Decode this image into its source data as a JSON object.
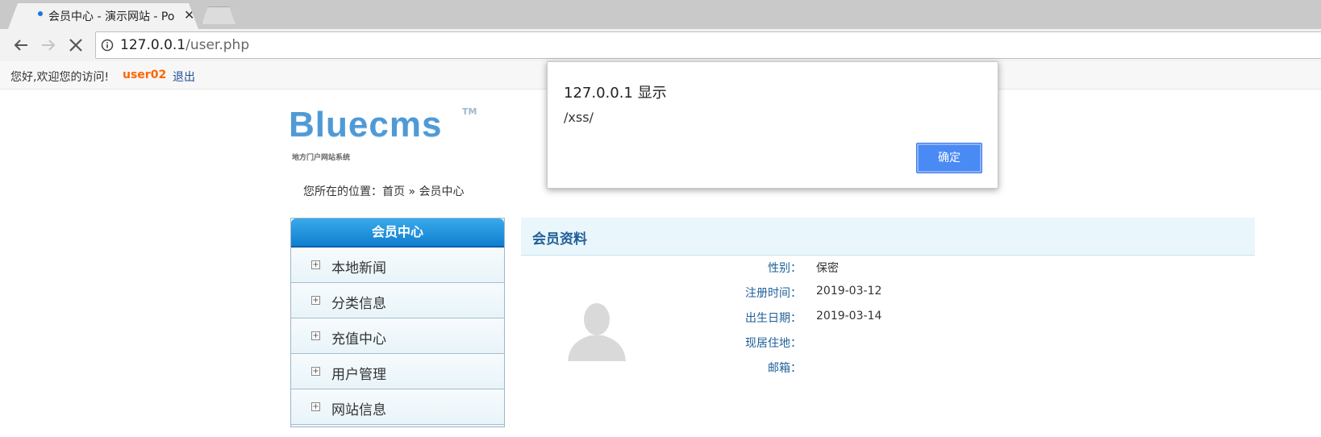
{
  "browser": {
    "tab_title": "会员中心 - 演示网站 - Po",
    "tab_close": "✕",
    "url_host": "127.0.0.1",
    "url_path": "/user.php"
  },
  "topbar": {
    "welcome": "您好,欢迎您的访问!",
    "username": "user02",
    "logout": "退出"
  },
  "logo": {
    "text": "Bluecms",
    "tm": "TM",
    "subtitle": "地方门户网站系统"
  },
  "breadcrumb": "您所在的位置：首页 » 会员中心",
  "sidemenu": {
    "title": "会员中心",
    "items": [
      {
        "label": "本地新闻"
      },
      {
        "label": "分类信息"
      },
      {
        "label": "充值中心"
      },
      {
        "label": "用户管理"
      },
      {
        "label": "网站信息"
      }
    ]
  },
  "profile": {
    "title": "会员资料",
    "fields": [
      {
        "label": "性别：",
        "value": "保密"
      },
      {
        "label": "注册时间：",
        "value": "2019-03-12"
      },
      {
        "label": "出生日期：",
        "value": "2019-03-14"
      },
      {
        "label": "现居住地：",
        "value": ""
      },
      {
        "label": "邮箱：",
        "value": ""
      }
    ]
  },
  "dialog": {
    "title": "127.0.0.1 显示",
    "message": "/xss/",
    "ok": "确定"
  },
  "colors": {
    "accent": "#4a8af4",
    "username": "#ff6600",
    "menu_header": "#0f7fd0",
    "label_blue": "#1f5f98"
  }
}
